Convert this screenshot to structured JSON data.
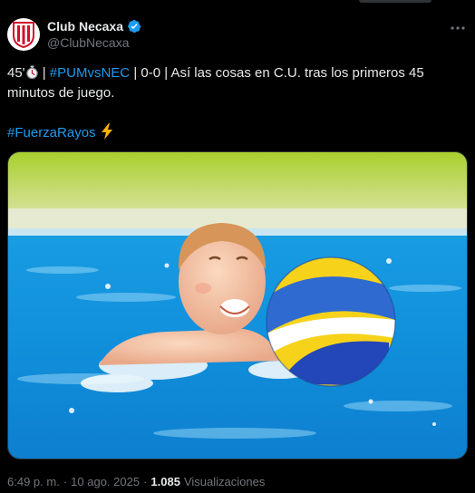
{
  "account": {
    "name": "Club Necaxa",
    "handle": "@ClubNecaxa",
    "verified": true
  },
  "icons": {
    "more": "more-horizontal-icon",
    "verified": "verified-badge-icon",
    "stopwatch": "stopwatch-emoji-icon",
    "bolt": "high-voltage-emoji-icon"
  },
  "tweet": {
    "minute": "45'",
    "sep1": " | ",
    "hashtag_match": "#PUMvsNEC",
    "body": " | 0-0 | Así las cosas en C.U. tras los primeros 45 minutos de juego.",
    "hashtag_team": "#FuerzaRayos"
  },
  "meta": {
    "time": "6:49 p. m.",
    "dot": "·",
    "date": "10 ago. 2025",
    "dot2": "·",
    "views_count": "1.085",
    "views_label": "Visualizaciones"
  },
  "colors": {
    "background": "#000000",
    "text": "#e7e9ea",
    "secondary": "#71767b",
    "link": "#1d9bf0",
    "verified": "#1d9bf0"
  }
}
